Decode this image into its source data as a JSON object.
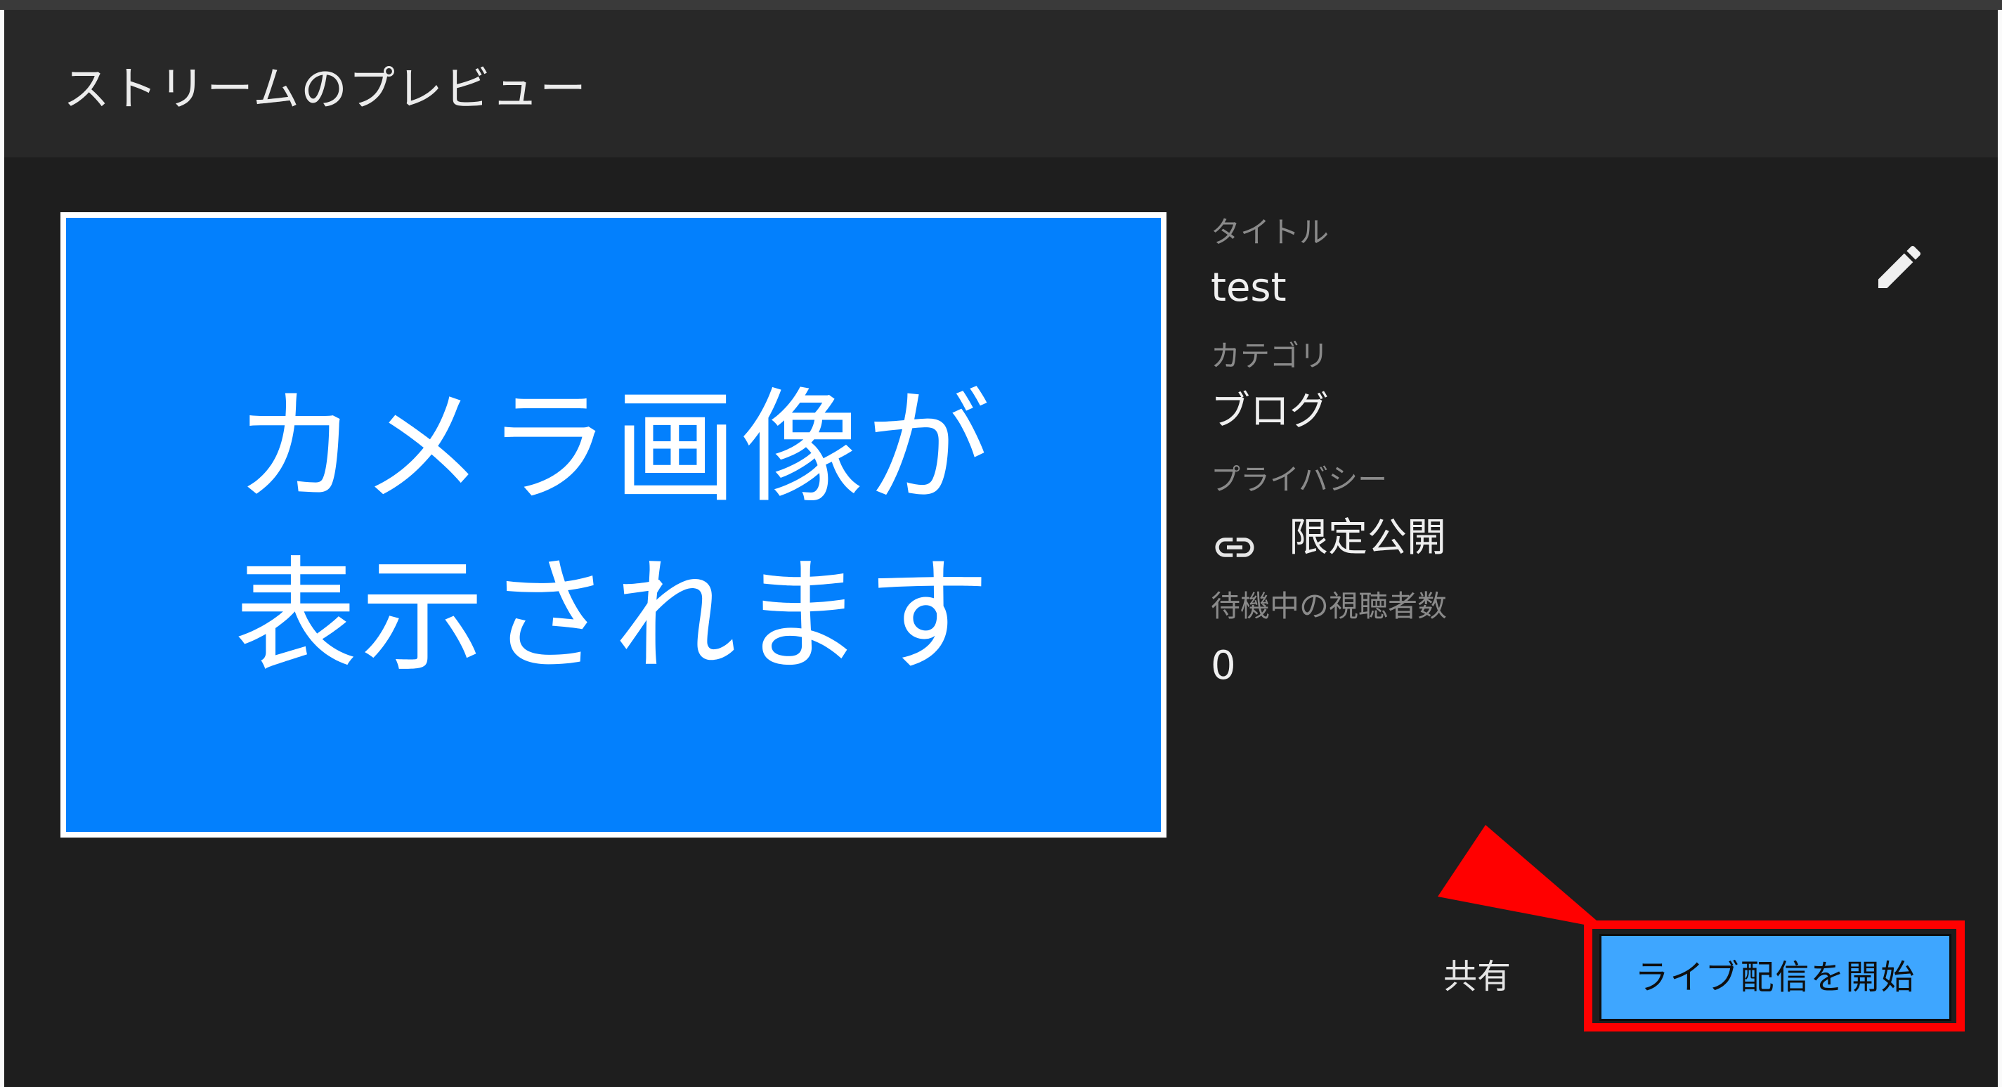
{
  "dialog": {
    "title": "ストリームのプレビュー"
  },
  "preview": {
    "line1": "カメラ画像が",
    "line2": "表示されます"
  },
  "details": {
    "title_label": "タイトル",
    "title_value": "test",
    "category_label": "カテゴリ",
    "category_value": "ブログ",
    "privacy_label": "プライバシー",
    "privacy_value": "限定公開",
    "waiting_label": "待機中の視聴者数",
    "waiting_value": "0"
  },
  "actions": {
    "share_label": "共有",
    "start_label": "ライブ配信を開始"
  },
  "icons": {
    "edit": "pencil-icon",
    "privacy": "link-icon",
    "annotation": "red-arrow-icon"
  },
  "colors": {
    "dialog_bg": "#1e1e1e",
    "header_bg": "#282828",
    "preview_bg": "#0380fd",
    "primary_button": "#3ea6ff",
    "highlight": "#ff0000"
  }
}
